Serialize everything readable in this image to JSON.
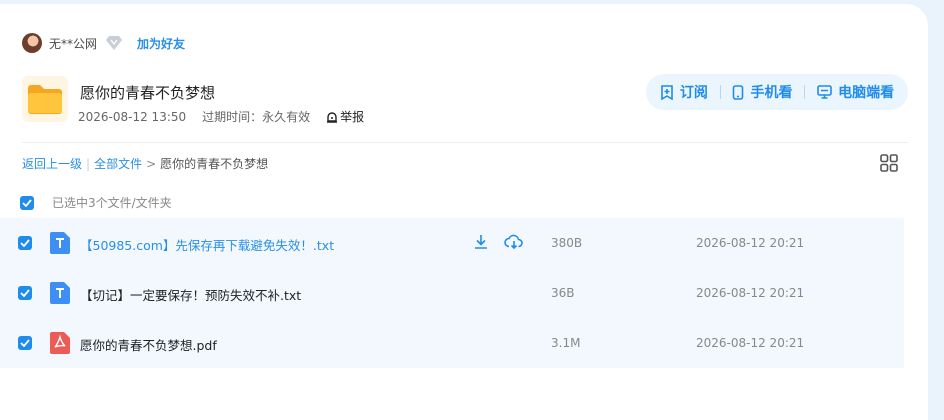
{
  "owner": {
    "name": "无**公网",
    "add_friend": "加为好友"
  },
  "folder": {
    "title": "愿你的青春不负梦想",
    "date": "2026-08-12 13:50",
    "expire_label": "过期时间：永久有效",
    "report": "举报"
  },
  "actions": {
    "subscribe": "订阅",
    "mobile": "手机看",
    "desktop": "电脑端看"
  },
  "breadcrumb": {
    "back": "返回上一级",
    "all": "全部文件",
    "separator": ">",
    "current": "愿你的青春不负梦想"
  },
  "selection": {
    "text": "已选中3个文件/文件夹"
  },
  "files": [
    {
      "name": "【50985.com】先保存再下载避免失效！.txt",
      "size": "380B",
      "date": "2026-08-12 20:21",
      "type": "txt"
    },
    {
      "name": "【切记】一定要保存！预防失效不补.txt",
      "size": "36B",
      "date": "2026-08-12 20:21",
      "type": "txt"
    },
    {
      "name": "愿你的青春不负梦想.pdf",
      "size": "3.1M",
      "date": "2026-08-12 20:21",
      "type": "pdf"
    }
  ],
  "colors": {
    "accent": "#1f8ceb",
    "row_bg": "#f2f8fe",
    "pdf_red": "#ec5b56",
    "txt_blue": "#3d8ef5",
    "folder_yellow": "#ffc53d"
  }
}
